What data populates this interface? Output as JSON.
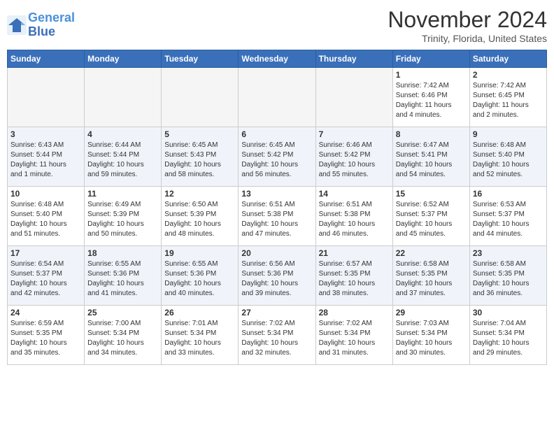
{
  "header": {
    "logo": {
      "line1": "General",
      "line2": "Blue"
    },
    "title": "November 2024",
    "location": "Trinity, Florida, United States"
  },
  "weekdays": [
    "Sunday",
    "Monday",
    "Tuesday",
    "Wednesday",
    "Thursday",
    "Friday",
    "Saturday"
  ],
  "weeks": [
    [
      {
        "day": "",
        "info": "",
        "empty": true
      },
      {
        "day": "",
        "info": "",
        "empty": true
      },
      {
        "day": "",
        "info": "",
        "empty": true
      },
      {
        "day": "",
        "info": "",
        "empty": true
      },
      {
        "day": "",
        "info": "",
        "empty": true
      },
      {
        "day": "1",
        "info": "Sunrise: 7:42 AM\nSunset: 6:46 PM\nDaylight: 11 hours\nand 4 minutes.",
        "empty": false
      },
      {
        "day": "2",
        "info": "Sunrise: 7:42 AM\nSunset: 6:45 PM\nDaylight: 11 hours\nand 2 minutes.",
        "empty": false
      }
    ],
    [
      {
        "day": "3",
        "info": "Sunrise: 6:43 AM\nSunset: 5:44 PM\nDaylight: 11 hours\nand 1 minute.",
        "empty": false
      },
      {
        "day": "4",
        "info": "Sunrise: 6:44 AM\nSunset: 5:44 PM\nDaylight: 10 hours\nand 59 minutes.",
        "empty": false
      },
      {
        "day": "5",
        "info": "Sunrise: 6:45 AM\nSunset: 5:43 PM\nDaylight: 10 hours\nand 58 minutes.",
        "empty": false
      },
      {
        "day": "6",
        "info": "Sunrise: 6:45 AM\nSunset: 5:42 PM\nDaylight: 10 hours\nand 56 minutes.",
        "empty": false
      },
      {
        "day": "7",
        "info": "Sunrise: 6:46 AM\nSunset: 5:42 PM\nDaylight: 10 hours\nand 55 minutes.",
        "empty": false
      },
      {
        "day": "8",
        "info": "Sunrise: 6:47 AM\nSunset: 5:41 PM\nDaylight: 10 hours\nand 54 minutes.",
        "empty": false
      },
      {
        "day": "9",
        "info": "Sunrise: 6:48 AM\nSunset: 5:40 PM\nDaylight: 10 hours\nand 52 minutes.",
        "empty": false
      }
    ],
    [
      {
        "day": "10",
        "info": "Sunrise: 6:48 AM\nSunset: 5:40 PM\nDaylight: 10 hours\nand 51 minutes.",
        "empty": false
      },
      {
        "day": "11",
        "info": "Sunrise: 6:49 AM\nSunset: 5:39 PM\nDaylight: 10 hours\nand 50 minutes.",
        "empty": false
      },
      {
        "day": "12",
        "info": "Sunrise: 6:50 AM\nSunset: 5:39 PM\nDaylight: 10 hours\nand 48 minutes.",
        "empty": false
      },
      {
        "day": "13",
        "info": "Sunrise: 6:51 AM\nSunset: 5:38 PM\nDaylight: 10 hours\nand 47 minutes.",
        "empty": false
      },
      {
        "day": "14",
        "info": "Sunrise: 6:51 AM\nSunset: 5:38 PM\nDaylight: 10 hours\nand 46 minutes.",
        "empty": false
      },
      {
        "day": "15",
        "info": "Sunrise: 6:52 AM\nSunset: 5:37 PM\nDaylight: 10 hours\nand 45 minutes.",
        "empty": false
      },
      {
        "day": "16",
        "info": "Sunrise: 6:53 AM\nSunset: 5:37 PM\nDaylight: 10 hours\nand 44 minutes.",
        "empty": false
      }
    ],
    [
      {
        "day": "17",
        "info": "Sunrise: 6:54 AM\nSunset: 5:37 PM\nDaylight: 10 hours\nand 42 minutes.",
        "empty": false
      },
      {
        "day": "18",
        "info": "Sunrise: 6:55 AM\nSunset: 5:36 PM\nDaylight: 10 hours\nand 41 minutes.",
        "empty": false
      },
      {
        "day": "19",
        "info": "Sunrise: 6:55 AM\nSunset: 5:36 PM\nDaylight: 10 hours\nand 40 minutes.",
        "empty": false
      },
      {
        "day": "20",
        "info": "Sunrise: 6:56 AM\nSunset: 5:36 PM\nDaylight: 10 hours\nand 39 minutes.",
        "empty": false
      },
      {
        "day": "21",
        "info": "Sunrise: 6:57 AM\nSunset: 5:35 PM\nDaylight: 10 hours\nand 38 minutes.",
        "empty": false
      },
      {
        "day": "22",
        "info": "Sunrise: 6:58 AM\nSunset: 5:35 PM\nDaylight: 10 hours\nand 37 minutes.",
        "empty": false
      },
      {
        "day": "23",
        "info": "Sunrise: 6:58 AM\nSunset: 5:35 PM\nDaylight: 10 hours\nand 36 minutes.",
        "empty": false
      }
    ],
    [
      {
        "day": "24",
        "info": "Sunrise: 6:59 AM\nSunset: 5:35 PM\nDaylight: 10 hours\nand 35 minutes.",
        "empty": false
      },
      {
        "day": "25",
        "info": "Sunrise: 7:00 AM\nSunset: 5:34 PM\nDaylight: 10 hours\nand 34 minutes.",
        "empty": false
      },
      {
        "day": "26",
        "info": "Sunrise: 7:01 AM\nSunset: 5:34 PM\nDaylight: 10 hours\nand 33 minutes.",
        "empty": false
      },
      {
        "day": "27",
        "info": "Sunrise: 7:02 AM\nSunset: 5:34 PM\nDaylight: 10 hours\nand 32 minutes.",
        "empty": false
      },
      {
        "day": "28",
        "info": "Sunrise: 7:02 AM\nSunset: 5:34 PM\nDaylight: 10 hours\nand 31 minutes.",
        "empty": false
      },
      {
        "day": "29",
        "info": "Sunrise: 7:03 AM\nSunset: 5:34 PM\nDaylight: 10 hours\nand 30 minutes.",
        "empty": false
      },
      {
        "day": "30",
        "info": "Sunrise: 7:04 AM\nSunset: 5:34 PM\nDaylight: 10 hours\nand 29 minutes.",
        "empty": false
      }
    ]
  ]
}
